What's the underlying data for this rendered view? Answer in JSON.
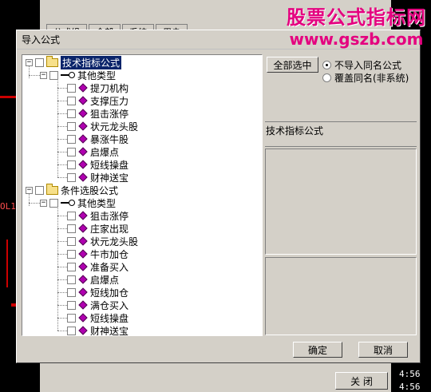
{
  "dialog": {
    "title": "导入公式",
    "select_all_label": "全部选中",
    "radio_options": [
      {
        "label": "不导入同名公式",
        "selected": true
      },
      {
        "label": "覆盖同名(非系统)",
        "selected": false
      }
    ],
    "info_title": "技术指标公式",
    "ok_label": "确定",
    "cancel_label": "取消"
  },
  "tree": {
    "groups": [
      {
        "label": "技术指标公式",
        "subgroup": "其他类型",
        "items": [
          "提刀机构",
          "支撑压力",
          "狙击涨停",
          "状元龙头股",
          "暴涨牛股",
          "启爆点",
          "短线操盘",
          "财神送宝"
        ]
      },
      {
        "label": "条件选股公式",
        "subgroup": "其他类型",
        "items": [
          "狙击涨停",
          "庄家出现",
          "状元龙头股",
          "牛市加仓",
          "准备买入",
          "启爆点",
          "短线加仓",
          "满仓买入",
          "短线操盘",
          "财神送宝"
        ]
      }
    ]
  },
  "background": {
    "tabs": [
      "公式组",
      "全部",
      "系统",
      "用户"
    ],
    "left_text": "OL1",
    "right_times": [
      "4:56",
      "4:56"
    ],
    "close_button": "关 闭",
    "watermark_cn": "股票公式指标网",
    "watermark_url": "www.gszb.com"
  }
}
